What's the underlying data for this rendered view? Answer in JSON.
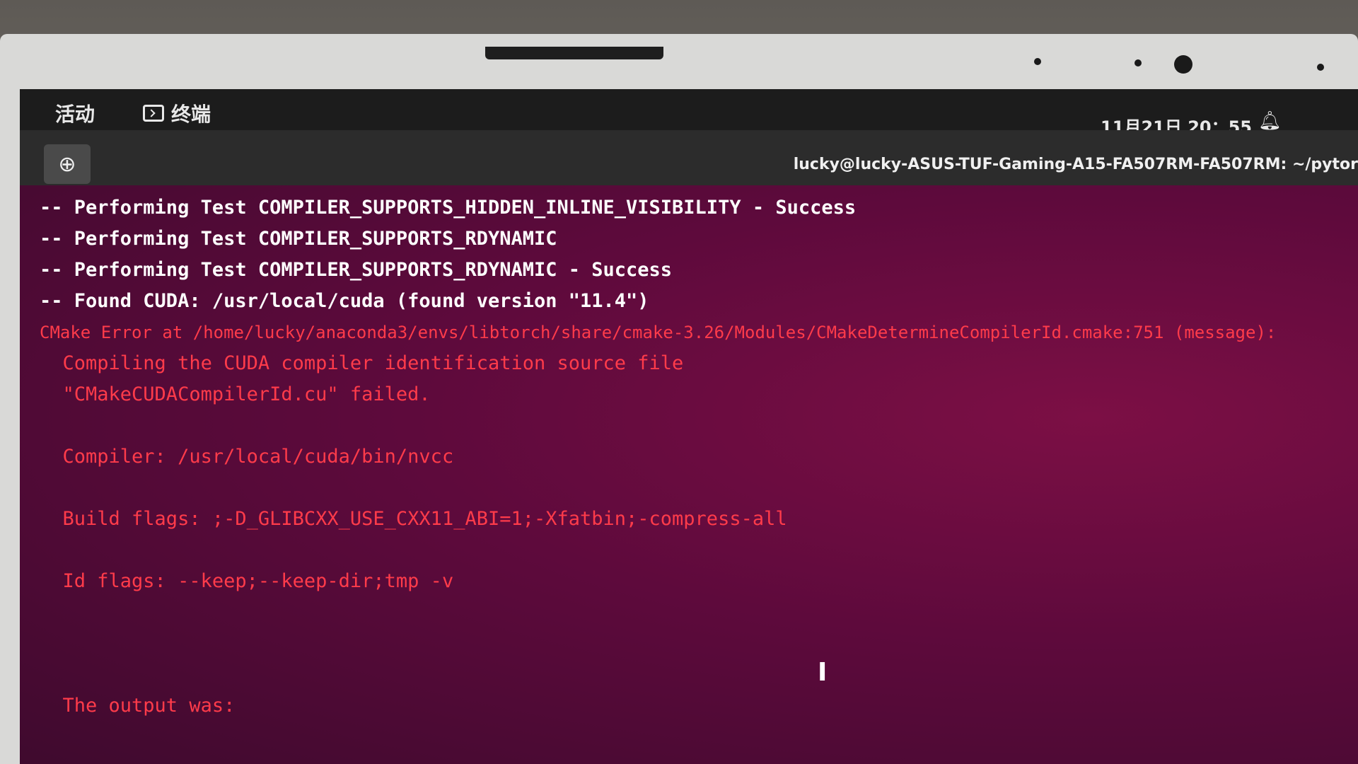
{
  "topbar": {
    "activities_label": "活动",
    "app_name": "终端",
    "clock": "11月21日 20：55",
    "app_icon": "terminal-icon",
    "notification_icon": "bell-icon"
  },
  "titlebar": {
    "new_tab_icon": "new-tab-icon",
    "title": "lucky@lucky-ASUS-TUF-Gaming-A15-FA507RM-FA507RM: ~/pytor"
  },
  "terminal": {
    "lines": [
      "-- Performing Test COMPILER_SUPPORTS_HIDDEN_INLINE_VISIBILITY - Success",
      "-- Performing Test COMPILER_SUPPORTS_RDYNAMIC",
      "-- Performing Test COMPILER_SUPPORTS_RDYNAMIC - Success",
      "-- Found CUDA: /usr/local/cuda (found version \"11.4\")",
      "CMake Error at /home/lucky/anaconda3/envs/libtorch/share/cmake-3.26/Modules/CMakeDetermineCompilerId.cmake:751 (message):",
      "  Compiling the CUDA compiler identification source file",
      "  \"CMakeCUDACompilerId.cu\" failed.",
      "  Compiler: /usr/local/cuda/bin/nvcc",
      "  Build flags: ;-D_GLIBCXX_USE_CXX11_ABI=1;-Xfatbin;-compress-all",
      "  Id flags: --keep;--keep-dir;tmp -v",
      "  The output was:"
    ]
  },
  "colors": {
    "terminal_background": "#5e0a3c",
    "error_text": "#ff3b4a",
    "normal_text": "#ffffff",
    "topbar": "#1c1c1c",
    "titlebar": "#2c2c2c"
  }
}
